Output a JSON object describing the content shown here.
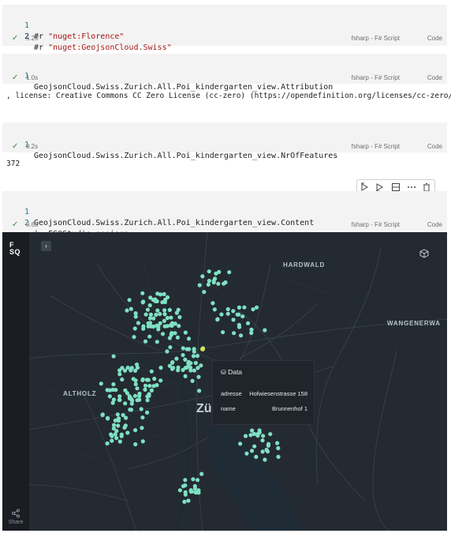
{
  "cells": [
    {
      "lines": [
        {
          "num": "1",
          "keyword": "#r",
          "string": "\"nuget:Florence\""
        },
        {
          "num": "2",
          "keyword": "#r",
          "string": "\"nuget:GeojsonCloud.Swiss\""
        }
      ],
      "time": "5.2s",
      "language": "fsharp - F# Script",
      "kind": "Code"
    },
    {
      "lines": [
        {
          "num": "1",
          "text": "GeojsonCloud.Swiss.Zurich.All.Poi_kindergarten_view.Attribution"
        }
      ],
      "time": "1.0s",
      "language": "fsharp - F# Script",
      "kind": "Code",
      "output": ", license: Creative Commons CC Zero License (cc-zero) (https://opendefinition.org/licenses/cc-zero/)"
    },
    {
      "lines": [
        {
          "num": "1",
          "text": "GeojsonCloud.Swiss.Zurich.All.Poi_kindergarten_view.NrOfFeatures"
        }
      ],
      "time": "0.2s",
      "language": "fsharp - F# Script",
      "kind": "Code",
      "output": "372"
    },
    {
      "lines": [
        {
          "num": "1",
          "text": "GeojsonCloud.Swiss.Zurich.All.Poi_kindergarten_view.Content"
        },
        {
          "num": "2",
          "text": "|> FSQStudio.geojson"
        }
      ],
      "time": "0.6s",
      "language": "fsharp - F# Script",
      "kind": "Code"
    }
  ],
  "cell_toolbar": {
    "icons": [
      "execute-above-icon",
      "execute-below-icon",
      "split-cell-icon",
      "more-icon",
      "delete-icon"
    ]
  },
  "map": {
    "logo_line1": "F",
    "logo_line2": "SQ",
    "labels": {
      "hardwald": "HARDWALD",
      "wangenerwald": "WANGENERWA",
      "altholz": "ALTHOLZ",
      "zurich": "Zü"
    },
    "tooltip": {
      "title": "Data",
      "rows": [
        {
          "key": "adresse",
          "value": "Hofwiesenstrasse 158"
        },
        {
          "key": "name",
          "value": "Brunnenhof 1"
        }
      ]
    },
    "share_label": "Share",
    "point_color": "#7fe0c4",
    "highlight_color": "#d7e34b"
  }
}
